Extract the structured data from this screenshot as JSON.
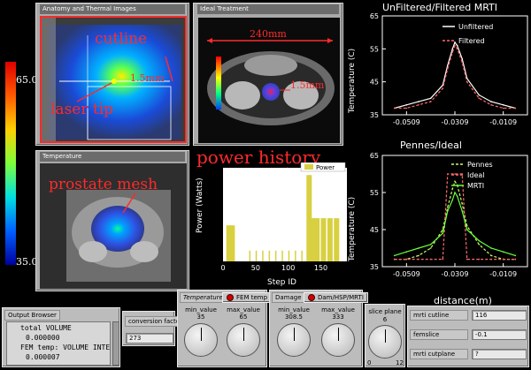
{
  "colorbar": {
    "max_label": "65.0",
    "min_label": "35.0"
  },
  "panels": {
    "anatomy": {
      "title": "Anatomy and Thermal Images",
      "annotations": {
        "cutline": "cutline",
        "size": "1.5mm",
        "laser": "laser tip"
      }
    },
    "ideal": {
      "title": "Ideal Treatment",
      "annotations": {
        "width": "240mm",
        "size": "1.5mm"
      }
    },
    "temperature": {
      "title": "Temperature",
      "annotations": {
        "mesh": "prostate mesh"
      }
    }
  },
  "power_history_label": "power history",
  "charts": {
    "unfiltered": {
      "title": "UnFiltered/Filtered MRTI",
      "ylabel": "Temperature (C)",
      "yticks": [
        "65",
        "55",
        "45",
        "35"
      ],
      "xticks": [
        "-0.0509",
        "-0.0309",
        "-0.0109"
      ],
      "legend": [
        "Unfiltered",
        "Filtered"
      ]
    },
    "pennes": {
      "title": "Pennes/Ideal",
      "ylabel": "Temperature (C)",
      "yticks": [
        "65",
        "55",
        "45",
        "35"
      ],
      "xticks": [
        "-0.0509",
        "-0.0309",
        "-0.0109"
      ],
      "legend": [
        "Pennes",
        "Ideal",
        "MRTI"
      ],
      "xlabel": "distance(m)"
    },
    "power": {
      "ylabel": "Power (Watts)",
      "xlabel": "Step ID",
      "xticks": [
        "0",
        "50",
        "100",
        "150"
      ],
      "legend": [
        "Power"
      ]
    }
  },
  "chart_data": [
    {
      "type": "line",
      "title": "UnFiltered/Filtered MRTI",
      "ylabel": "Temperature (C)",
      "xlim": [
        -0.0609,
        -0.0009
      ],
      "ylim": [
        35,
        65
      ],
      "x": [
        -0.0559,
        -0.0509,
        -0.0459,
        -0.0409,
        -0.0359,
        -0.0339,
        -0.0319,
        -0.0309,
        -0.0299,
        -0.0279,
        -0.0259,
        -0.0209,
        -0.0159,
        -0.0109,
        -0.0059
      ],
      "series": [
        {
          "name": "Unfiltered",
          "color": "#ffffff",
          "values": [
            37,
            38,
            39,
            40,
            44,
            50,
            55,
            57,
            56,
            52,
            46,
            41,
            39,
            38,
            37
          ]
        },
        {
          "name": "Filtered",
          "color": "#ff6a6a",
          "values": [
            37,
            37,
            38,
            39,
            43,
            49,
            54,
            56,
            55,
            51,
            45,
            40,
            38,
            37,
            37
          ]
        }
      ]
    },
    {
      "type": "line",
      "title": "Pennes/Ideal",
      "ylabel": "Temperature (C)",
      "xlabel": "distance(m)",
      "xlim": [
        -0.0609,
        -0.0009
      ],
      "ylim": [
        35,
        65
      ],
      "x": [
        -0.0559,
        -0.0509,
        -0.0459,
        -0.0409,
        -0.0359,
        -0.0339,
        -0.0319,
        -0.0309,
        -0.0299,
        -0.0279,
        -0.0259,
        -0.0209,
        -0.0159,
        -0.0109,
        -0.0059
      ],
      "series": [
        {
          "name": "Pennes",
          "color": "#c8ff6a",
          "values": [
            37,
            37,
            38,
            40,
            45,
            51,
            56,
            58,
            57,
            52,
            46,
            41,
            38,
            37,
            37
          ]
        },
        {
          "name": "Ideal",
          "color": "#ff6a6a",
          "values": [
            37,
            37,
            37,
            37,
            37,
            60,
            60,
            60,
            60,
            60,
            37,
            37,
            37,
            37,
            37
          ]
        },
        {
          "name": "MRTI",
          "color": "#6cff3a",
          "values": [
            38,
            39,
            40,
            41,
            44,
            50,
            53,
            55,
            54,
            50,
            45,
            42,
            40,
            39,
            38
          ]
        }
      ]
    },
    {
      "type": "bar",
      "ylabel": "Power (Watts)",
      "xlabel": "Step ID",
      "xlim": [
        0,
        190
      ],
      "x_steps": [
        5,
        10,
        40,
        50,
        60,
        70,
        80,
        90,
        100,
        110,
        120,
        128,
        133,
        140,
        150,
        160,
        170
      ],
      "values": [
        5,
        5,
        1.5,
        1.5,
        1.5,
        1.5,
        1.5,
        1.5,
        1.5,
        1.5,
        1.5,
        12,
        6,
        6,
        6,
        6,
        6
      ],
      "legend": [
        "Power"
      ],
      "color": "#d8d040"
    }
  ],
  "widgets": {
    "output_browser": {
      "title": "Output Browser",
      "lines": [
        "total VOLUME",
        "0.000000",
        "FEM  temp: VOLUME INTE",
        "0.000007"
      ]
    },
    "conversion": {
      "label": "conversion factor",
      "value": "273"
    },
    "temperature_group": {
      "title": "Temperature",
      "button": "FEM temp",
      "dials": [
        {
          "label": "min_value",
          "value": "35"
        },
        {
          "label": "max_value",
          "value": "65"
        }
      ]
    },
    "damage_group": {
      "title": "Damage",
      "button": "Dam/HSP/MRTI",
      "dials": [
        {
          "label": "min_value",
          "value": "308.5"
        },
        {
          "label": "max_value",
          "value": "333"
        }
      ]
    },
    "slice_plane": {
      "label": "slice plane",
      "value": "6",
      "min": "0",
      "max": "12"
    },
    "mrti_fields": [
      {
        "label": "mrti cutline",
        "value": "116"
      },
      {
        "label": "femslice",
        "value": "-0.1"
      },
      {
        "label": "mrti cutplane",
        "value": "?"
      }
    ]
  }
}
